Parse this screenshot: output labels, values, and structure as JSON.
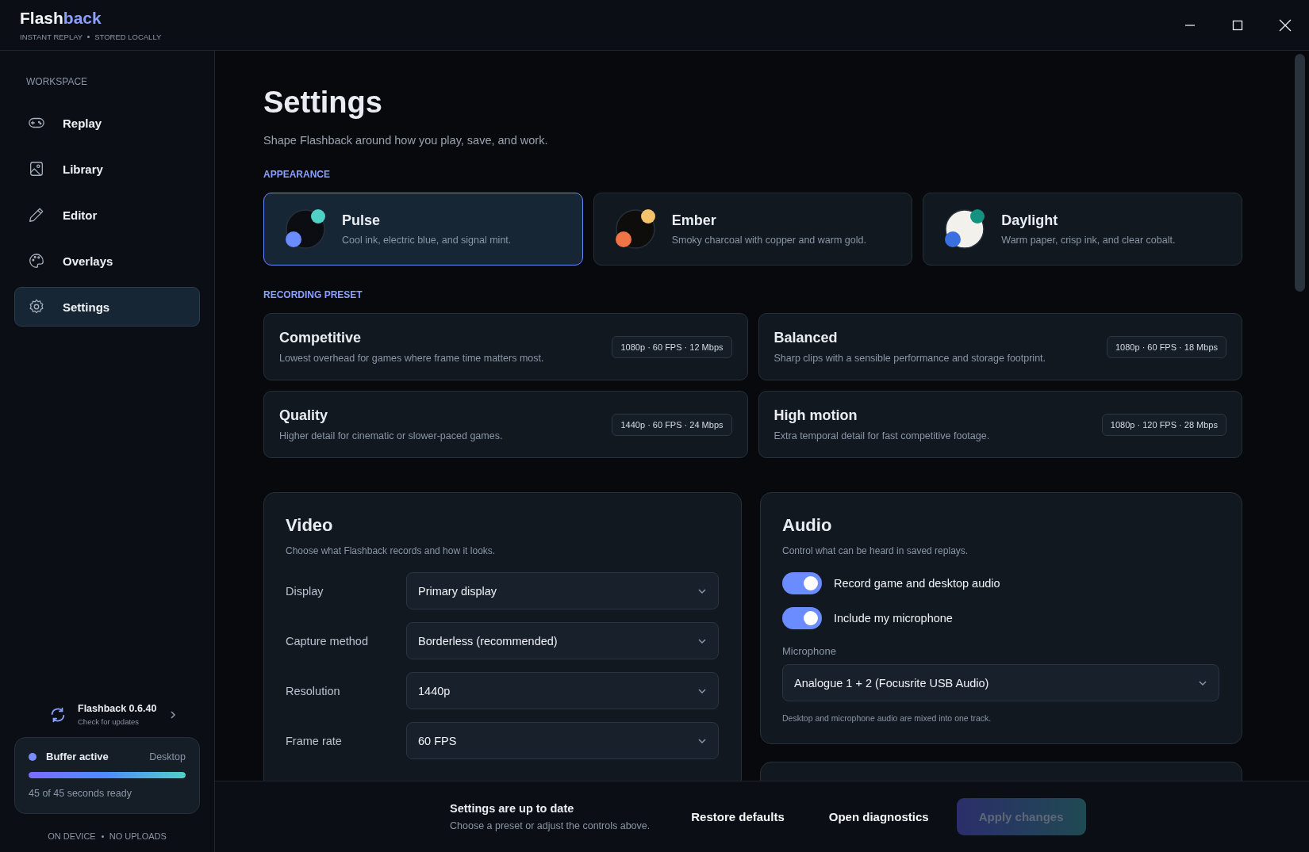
{
  "app": {
    "name_plain": "Flash",
    "name_accent": "back",
    "tagline": [
      "INSTANT REPLAY",
      "STORED LOCALLY"
    ]
  },
  "sidebar": {
    "section": "WORKSPACE",
    "items": [
      {
        "label": "Replay",
        "selected": false
      },
      {
        "label": "Library",
        "selected": false
      },
      {
        "label": "Editor",
        "selected": false
      },
      {
        "label": "Overlays",
        "selected": false
      },
      {
        "label": "Settings",
        "selected": true
      }
    ],
    "update": {
      "title": "Flashback 0.6.40",
      "subtitle": "Check for updates"
    },
    "buffer": {
      "status": "Buffer active",
      "source": "Desktop",
      "level": 1.0,
      "reading": "45 of 45 seconds ready"
    },
    "footer": [
      "ON DEVICE",
      "NO UPLOADS"
    ]
  },
  "page": {
    "title": "Settings",
    "subtitle": "Shape Flashback around how you play, save, and work."
  },
  "appearance": {
    "heading": "APPEARANCE",
    "themes": [
      {
        "name": "Pulse",
        "description": "Cool ink, electric blue, and signal mint.",
        "selected": true,
        "swatch": [
          {
            "color": "#0b0d12"
          },
          {
            "color": "#4fd1c5"
          },
          {
            "color": "#6b8cff"
          }
        ]
      },
      {
        "name": "Ember",
        "description": "Smoky charcoal with copper and warm gold.",
        "selected": false,
        "swatch": [
          {
            "color": "#0e0d0c"
          },
          {
            "color": "#f2c36b"
          },
          {
            "color": "#ef7446"
          }
        ]
      },
      {
        "name": "Daylight",
        "description": "Warm paper, crisp ink, and clear cobalt.",
        "selected": false,
        "swatch": [
          {
            "color": "#f3f1ec"
          },
          {
            "color": "#14917f"
          },
          {
            "color": "#3b6fe0"
          }
        ]
      }
    ]
  },
  "recording_preset": {
    "heading": "RECORDING PRESET",
    "presets": [
      {
        "name": "Competitive",
        "description": "Lowest overhead for games where frame time matters most.",
        "badge": "1080p · 60 FPS · 12 Mbps",
        "selected": false
      },
      {
        "name": "Balanced",
        "description": "Sharp clips with a sensible performance and storage footprint.",
        "badge": "1080p · 60 FPS · 18 Mbps",
        "selected": false
      },
      {
        "name": "Quality",
        "description": "Higher detail for cinematic or slower-paced games.",
        "badge": "1440p · 60 FPS · 24 Mbps",
        "selected": false
      },
      {
        "name": "High motion",
        "description": "Extra temporal detail for fast competitive footage.",
        "badge": "1080p · 120 FPS · 28 Mbps",
        "selected": false
      }
    ]
  },
  "video": {
    "title": "Video",
    "description": "Choose what Flashback records and how it looks.",
    "fields": [
      {
        "label": "Display",
        "value": "Primary display"
      },
      {
        "label": "Capture method",
        "value": "Borderless (recommended)"
      },
      {
        "label": "Resolution",
        "value": "1440p"
      },
      {
        "label": "Frame rate",
        "value": "60 FPS"
      }
    ]
  },
  "audio": {
    "title": "Audio",
    "description": "Control what can be heard in saved replays.",
    "toggles": [
      {
        "label": "Record game and desktop audio",
        "on": true
      },
      {
        "label": "Include my microphone",
        "on": true
      }
    ],
    "microphone": {
      "label": "Microphone",
      "value": "Analogue 1 + 2 (Focusrite USB Audio)"
    },
    "note": "Desktop and microphone audio are mixed into one track."
  },
  "status_bar": {
    "title": "Settings are up to date",
    "subtitle": "Choose a preset or adjust the controls above.",
    "buttons": [
      {
        "label": "Restore defaults",
        "kind": "plain",
        "disabled": false
      },
      {
        "label": "Open diagnostics",
        "kind": "plain",
        "disabled": false
      },
      {
        "label": "Apply changes",
        "kind": "primary",
        "disabled": true
      }
    ]
  }
}
